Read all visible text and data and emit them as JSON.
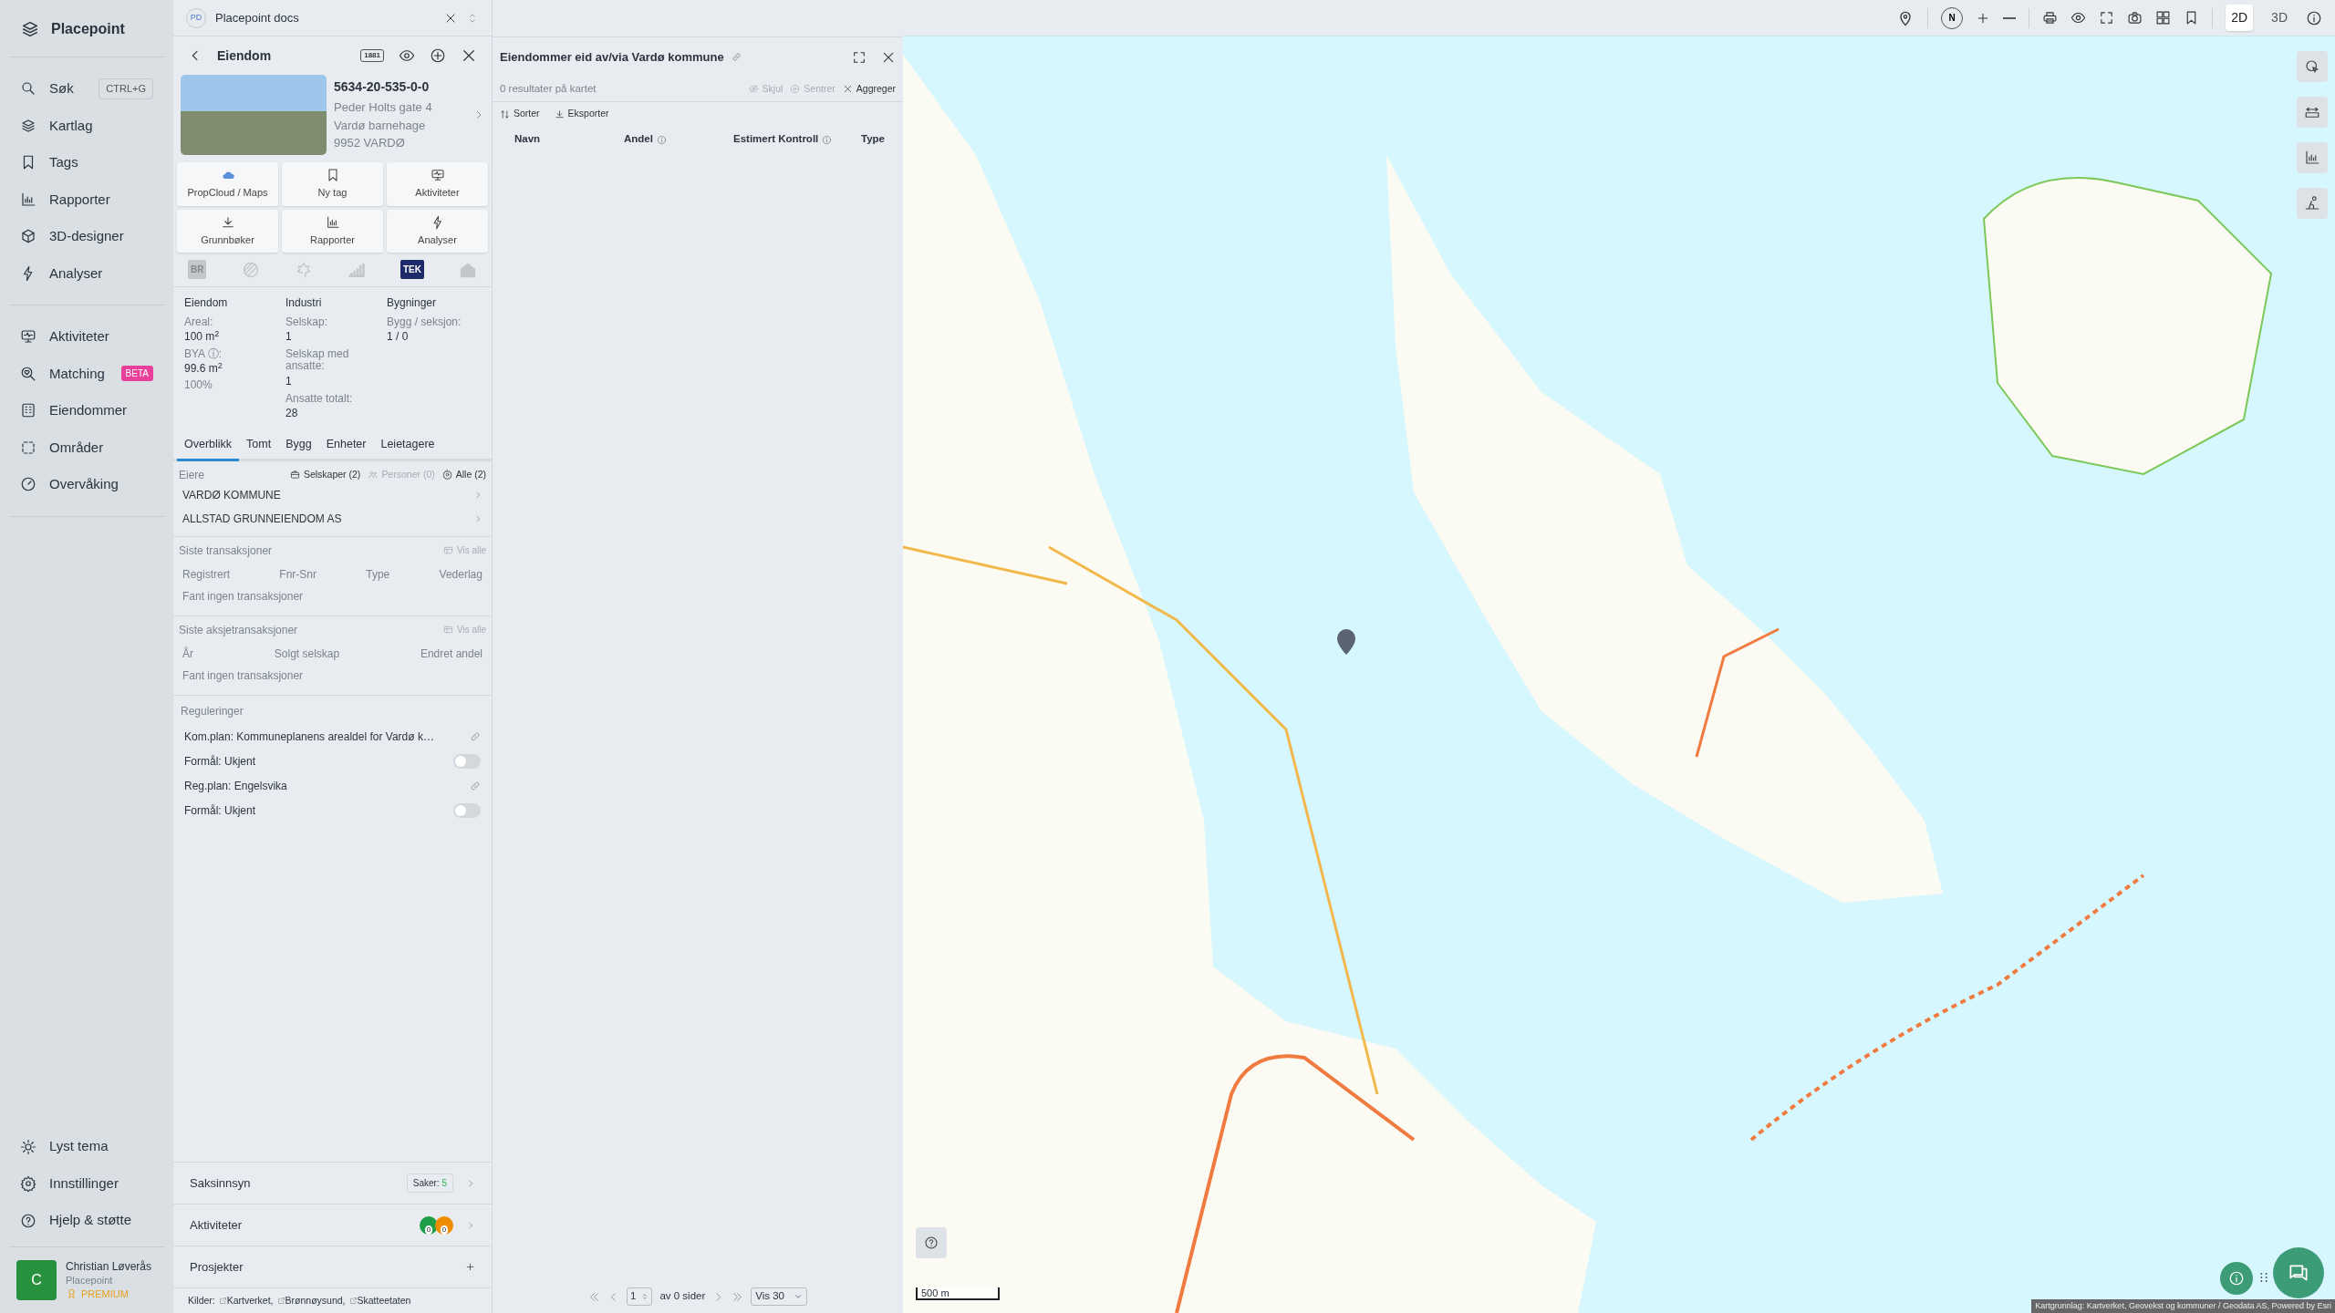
{
  "app": {
    "name": "Placepoint"
  },
  "sidebar": {
    "items": [
      {
        "label": "Søk",
        "shortcut": "CTRL+G"
      },
      {
        "label": "Kartlag"
      },
      {
        "label": "Tags"
      },
      {
        "label": "Rapporter"
      },
      {
        "label": "3D-designer"
      },
      {
        "label": "Analyser"
      }
    ],
    "items2": [
      {
        "label": "Aktiviteter"
      },
      {
        "label": "Matching",
        "badge": "BETA"
      },
      {
        "label": "Eiendommer"
      },
      {
        "label": "Områder"
      },
      {
        "label": "Overvåking"
      }
    ],
    "bottom_items": [
      {
        "label": "Lyst tema"
      },
      {
        "label": "Innstillinger"
      },
      {
        "label": "Hjelp & støtte"
      }
    ],
    "user": {
      "initial": "C",
      "name": "Christian Løverås",
      "org": "Placepoint",
      "plan": "PREMIUM"
    }
  },
  "workspace": {
    "initials": "PD",
    "label": "Placepoint docs"
  },
  "property_panel": {
    "title": "Eiendom",
    "badge_1881": "1881",
    "code": "5634-20-535-0-0",
    "address_lines": [
      "Peder Holts gate 4",
      "Vardø barnehage",
      "9952 VARDØ"
    ],
    "actions": [
      {
        "label": "PropCloud / Maps"
      },
      {
        "label": "Ny tag"
      },
      {
        "label": "Aktiviteter"
      },
      {
        "label": "Grunnbøker"
      },
      {
        "label": "Rapporter"
      },
      {
        "label": "Analyser"
      }
    ],
    "indicators": [
      {
        "kind": "text",
        "text": "BR",
        "active": false
      },
      {
        "kind": "icon",
        "active": false
      },
      {
        "kind": "icon",
        "active": false
      },
      {
        "kind": "icon",
        "active": false
      },
      {
        "kind": "text",
        "text": "TEK",
        "active": true
      },
      {
        "kind": "icon",
        "active": false
      }
    ],
    "summary": [
      {
        "heading": "Eiendom",
        "fields": [
          {
            "label": "Areal:",
            "value": "100 m$^{2}$"
          },
          {
            "label": "BYA ⓘ:",
            "value": "99.6 m$^{2}$",
            "note": "100%"
          }
        ]
      },
      {
        "heading": "Industri",
        "fields": [
          {
            "label": "Selskap:",
            "value": "1"
          },
          {
            "label": "Selskap med ansatte:",
            "value": "1"
          },
          {
            "label": "Ansatte totalt:",
            "value": "28"
          }
        ]
      },
      {
        "heading": "Bygninger",
        "fields": [
          {
            "label": "Bygg / seksjon:",
            "value": "1 / 0"
          }
        ]
      }
    ],
    "tabs": [
      {
        "label": "Overblikk",
        "selected": true
      },
      {
        "label": "Tomt",
        "selected": false
      },
      {
        "label": "Bygg",
        "selected": false
      },
      {
        "label": "Enheter",
        "selected": false
      },
      {
        "label": "Leietagere",
        "selected": false
      }
    ],
    "owners": {
      "title": "Eiere",
      "filters": [
        {
          "label": "Selskaper (2)",
          "disabled": false
        },
        {
          "label": "Personer (0)",
          "disabled": true
        },
        {
          "label": "Alle (2)",
          "disabled": false
        }
      ],
      "items": [
        "VARDØ KOMMUNE",
        "ALLSTAD GRUNNEIENDOM AS"
      ]
    },
    "transactions": [
      {
        "title": "Siste transaksjoner",
        "link": "Vis alle",
        "columns": [
          "Registrert",
          "Fnr-Snr",
          "Type",
          "Vederlag"
        ],
        "empty": "Fant ingen transaksjoner"
      },
      {
        "title": "Siste aksjetransaksjoner",
        "link": "Vis alle",
        "columns": [
          "År",
          "Solgt selskap",
          "Endret andel"
        ],
        "empty": "Fant ingen transaksjoner"
      }
    ],
    "regulations": {
      "title": "Reguleringer",
      "items": [
        {
          "kind": "link",
          "text": "Kom.plan: Kommuneplanens arealdel for Vardø k…"
        },
        {
          "kind": "toggle",
          "text": "Formål: Ukjent",
          "on": false
        },
        {
          "kind": "link",
          "text": "Reg.plan: Engelsvika"
        },
        {
          "kind": "toggle",
          "text": "Formål: Ukjent",
          "on": false
        }
      ]
    },
    "footer_rows": [
      {
        "kind": "count",
        "label": "Saksinnsyn",
        "count_label": "Saker:",
        "count": "5"
      },
      {
        "kind": "activities",
        "label": "Aktiviteter",
        "badges": [
          {
            "count": "0",
            "color": "#1e9e47"
          },
          {
            "count": "0",
            "color": "#f08c00"
          }
        ]
      },
      {
        "kind": "add",
        "label": "Prosjekter"
      }
    ],
    "sources": {
      "label": "Kilder:",
      "items": [
        "Kartverket,",
        "Brønnøysund,",
        "Skatteetaten"
      ]
    }
  },
  "results_panel": {
    "title": "Eiendommer eid av/via Vardø kommune",
    "count_text": "0 resultater på kartet",
    "actions": [
      {
        "label": "Skjul",
        "disabled": true
      },
      {
        "label": "Sentrer",
        "disabled": true
      },
      {
        "label": "Aggreger",
        "disabled": false
      }
    ],
    "tools": [
      "Sorter",
      "Eksporter"
    ],
    "columns": [
      {
        "label": "Navn",
        "info": false
      },
      {
        "label": "Andel",
        "info": true
      },
      {
        "label": "Estimert Kontroll",
        "info": true
      },
      {
        "label": "Type",
        "info": false
      }
    ],
    "pagination": {
      "page": "1",
      "pages_text": "av 0 sider",
      "per_page": "Vis 30"
    }
  },
  "map": {
    "compass": "N",
    "view_modes": [
      {
        "label": "2D",
        "selected": true
      },
      {
        "label": "3D",
        "selected": false
      }
    ],
    "scale": "500 m",
    "attribution": "Kartgrunnlag: Kartverket, Geovekst og kommuner / Geodata AS, Powered by Esri"
  }
}
